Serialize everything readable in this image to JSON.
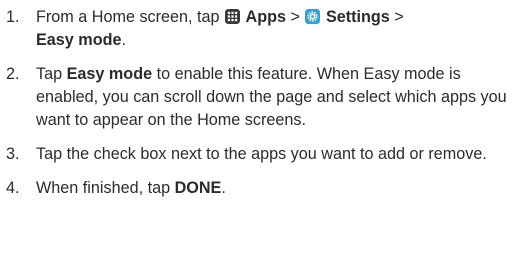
{
  "steps": [
    {
      "number": "1.",
      "text_a": "From a Home screen, tap ",
      "apps_label": "Apps",
      "sep1": " > ",
      "settings_label": "Settings",
      "sep2": " >",
      "easy_mode_label": "Easy mode",
      "end": "."
    },
    {
      "number": "2.",
      "text_a": "Tap ",
      "easy_mode_label": "Easy mode",
      "text_b": " to enable this feature. When Easy mode is enabled, you can scroll down the page and select which apps you want to appear on the Home screens."
    },
    {
      "number": "3.",
      "text": "Tap the check box next to the apps you want to add or remove."
    },
    {
      "number": "4.",
      "text_a": "When finished, tap ",
      "done_label": "DONE",
      "end": "."
    }
  ],
  "icons": {
    "apps": "apps-grid-icon",
    "settings": "settings-gear-icon"
  },
  "colors": {
    "apps_icon_bg": "#3a3a3a",
    "settings_icon_bg": "#2aa7d6"
  }
}
